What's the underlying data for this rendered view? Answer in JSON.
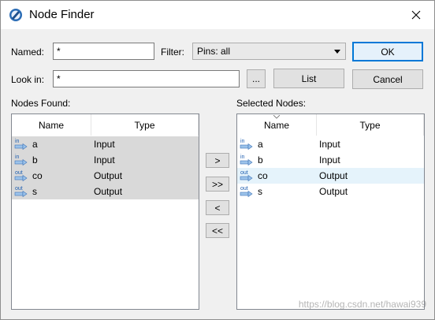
{
  "window": {
    "title": "Node Finder"
  },
  "form": {
    "named_label": "Named:",
    "named_value": "*",
    "filter_label": "Filter:",
    "filter_value": "Pins: all",
    "lookin_label": "Look in:",
    "lookin_value": "*",
    "browse_label": "...",
    "list_label": "List",
    "ok_label": "OK",
    "cancel_label": "Cancel"
  },
  "nodes_found": {
    "label": "Nodes Found:",
    "columns": [
      "Name",
      "Type"
    ],
    "rows": [
      {
        "icon": "pin-in",
        "name": "a",
        "type": "Input"
      },
      {
        "icon": "pin-in",
        "name": "b",
        "type": "Input"
      },
      {
        "icon": "pin-out",
        "name": "co",
        "type": "Output"
      },
      {
        "icon": "pin-out",
        "name": "s",
        "type": "Output"
      }
    ]
  },
  "transfer": {
    "add_one": ">",
    "add_all": ">>",
    "remove_one": "<",
    "remove_all": "<<"
  },
  "selected_nodes": {
    "label": "Selected Nodes:",
    "columns": [
      "Name",
      "Type"
    ],
    "rows": [
      {
        "icon": "pin-in",
        "name": "a",
        "type": "Input"
      },
      {
        "icon": "pin-in",
        "name": "b",
        "type": "Input"
      },
      {
        "icon": "pin-out",
        "name": "co",
        "type": "Output"
      },
      {
        "icon": "pin-out",
        "name": "s",
        "type": "Output"
      }
    ]
  },
  "watermark": "https://blog.csdn.net/hawai939",
  "colors": {
    "accent": "#0078d7",
    "row_selected": "#d9d9d9",
    "row_hover": "#e5f3fb"
  }
}
